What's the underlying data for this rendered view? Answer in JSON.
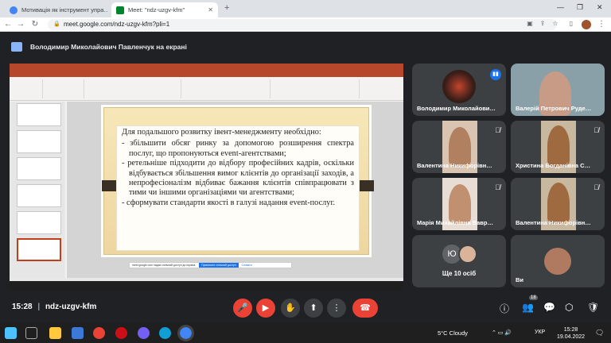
{
  "browser": {
    "tabs": [
      {
        "title": "Мотивація як інструмент упра…",
        "active": false
      },
      {
        "title": "Meet: \"ndz-uzgv-kfm\"",
        "active": true
      }
    ],
    "url": "meet.google.com/ndz-uzgv-kfm?pli=1"
  },
  "presenting_banner": "Володимир Миколайович Павленчук на екрані",
  "slide": {
    "heading": "Для подальшого розвитку івент-менеджменту необхідно:",
    "bullets": [
      "збільшити обсяг ринку за допомогою розширення спектра послуг, що пропонуються event-агентствами;",
      "ретельніше підходити до відбору професійних кадрів, оскільки відбувається збільшення вимог клієнтів до організації заходів, а непрофесіоналізм відбиває бажання клієнтів співпрацювати з тими чи іншими організаціями чи агентствами;",
      "сформувати стандарти якості в галузі надання event-послуг."
    ]
  },
  "shared_screen": {
    "notification": "meet.google.com надає спільний доступ до екрана.",
    "stop_sharing": "Припинити спільний доступ",
    "hide": "Сховати"
  },
  "participants": [
    {
      "name": "Володимир Миколайови…"
    },
    {
      "name": "Валерій Петрович Руде…"
    },
    {
      "name": "Валентина Никифорівн…"
    },
    {
      "name": "Христина Богданівна С…"
    },
    {
      "name": "Марія Михайлівна Вавр…"
    },
    {
      "name": "Валентина Никифорівн…"
    },
    {
      "name": "Ще 10 осіб"
    },
    {
      "name": "Ви"
    }
  ],
  "others_avatar_letter": "Ю",
  "people_badge": "18",
  "meeting": {
    "time": "15:28",
    "code": "ndz-uzgv-kfm"
  },
  "taskbar": {
    "weather": "5°C  Cloudy",
    "lang": "УКР",
    "time": "15:28",
    "date": "19.04.2022"
  },
  "colors": {
    "end_call": "#ea4335",
    "ppt": "#b7472a",
    "meet_bg": "#202124"
  }
}
